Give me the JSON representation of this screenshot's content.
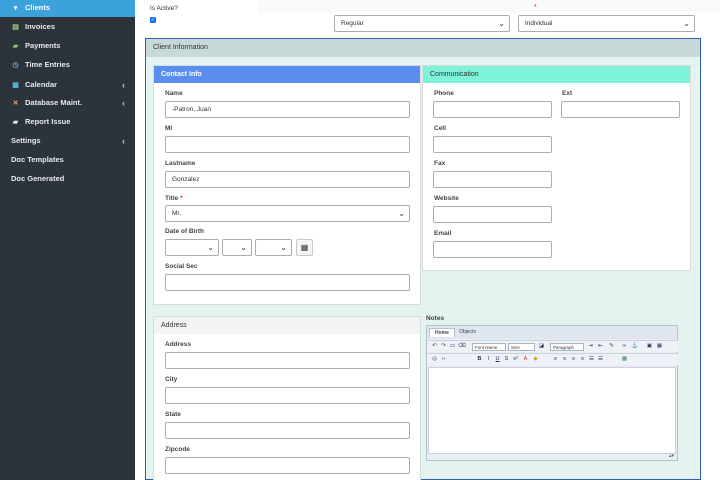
{
  "sidebar": {
    "items": [
      {
        "label": "Clients",
        "icon": "clients-icon",
        "glyph": "▾",
        "active": true
      },
      {
        "label": "Invoices",
        "icon": "invoices-icon",
        "glyph": "▤"
      },
      {
        "label": "Payments",
        "icon": "payments-icon",
        "glyph": "▰"
      },
      {
        "label": "Time Entries",
        "icon": "clock-icon",
        "glyph": "◷"
      },
      {
        "label": "Calendar",
        "icon": "calendar-icon",
        "glyph": "▦",
        "chevron": "‹"
      },
      {
        "label": "Database Maint.",
        "icon": "tools-icon",
        "glyph": "✕",
        "chevron": "‹"
      },
      {
        "label": "Report Issue",
        "icon": "comment-icon",
        "glyph": "▰"
      },
      {
        "label": "Settings",
        "chevron": "‹"
      },
      {
        "label": "Doc Templates"
      },
      {
        "label": "Doc Generated"
      }
    ]
  },
  "top": {
    "is_active_label": "Is Active?",
    "is_active_checked": true,
    "required_marker": "*",
    "type_select": "Regular",
    "kind_select": "Individual"
  },
  "client_info": {
    "title": "Client Information",
    "contact": {
      "title": "Contact Info",
      "name_label": "Name",
      "name_value": "-Patron, Juan",
      "mi_label": "MI",
      "mi_value": "",
      "lastname_label": "Lastname",
      "lastname_value": "Gonzalez",
      "title_label": "Title",
      "title_required": "*",
      "title_value": "Mr.",
      "dob_label": "Date of Birth",
      "social_label": "Social Sec",
      "social_value": ""
    },
    "communication": {
      "title": "Communication",
      "phone_label": "Phone",
      "ext_label": "Ext",
      "cell_label": "Cell",
      "fax_label": "Fax",
      "website_label": "Website",
      "email_label": "Email"
    },
    "address": {
      "title": "Address",
      "address_label": "Address",
      "city_label": "City",
      "state_label": "State",
      "zipcode_label": "Zipcode"
    },
    "notes": {
      "label": "Notes",
      "tabs": [
        "Home",
        "Objects"
      ],
      "font_name": "Font Name",
      "size": "Size",
      "paragraph": "Paragraph"
    }
  },
  "colors": {
    "sidebar_bg": "#2c333b",
    "active_item": "#3ca2db",
    "contact_head": "#5b8def",
    "communication_head": "#7ff3d9",
    "panel_border": "#2f5fb3"
  }
}
